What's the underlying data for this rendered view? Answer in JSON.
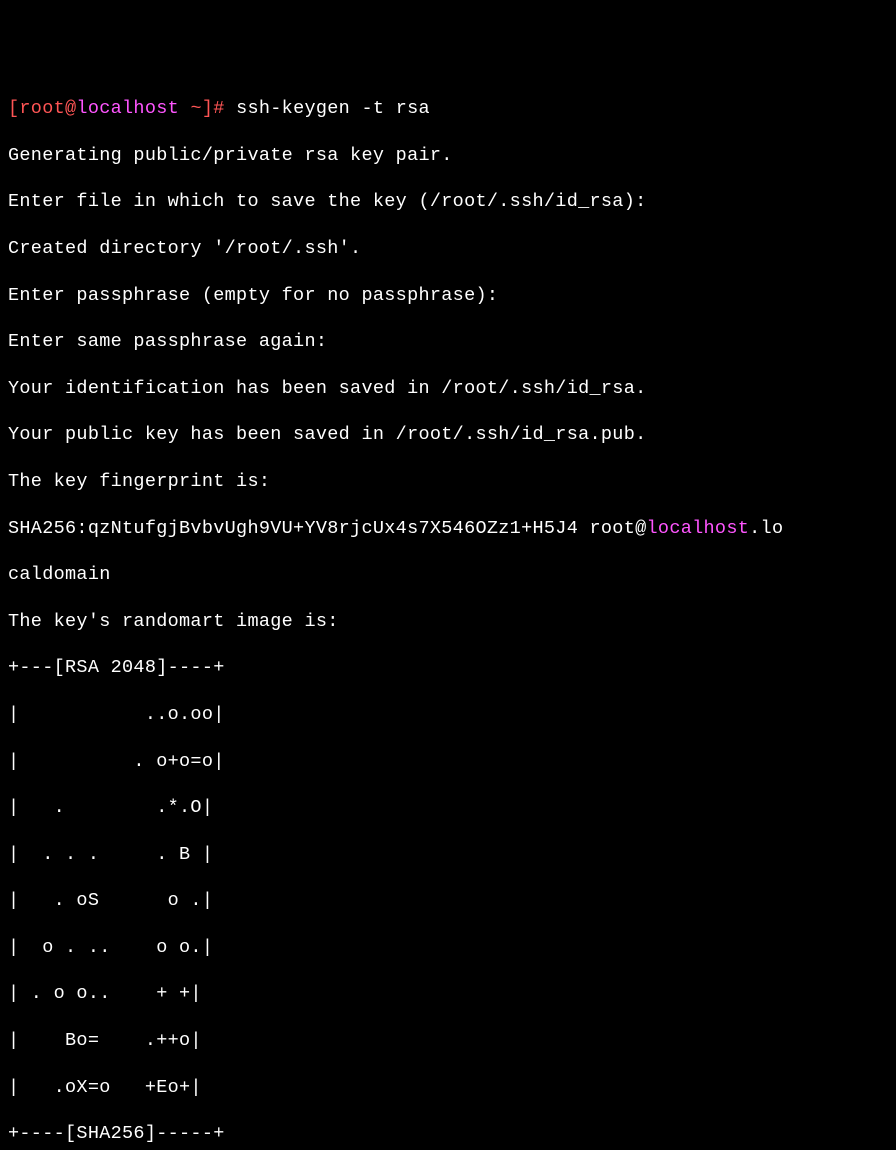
{
  "terminal": {
    "prompt_open": "[",
    "user": "root",
    "at": "@",
    "host": "localhost",
    "prompt_close": " ~]# ",
    "command": "ssh-keygen -t rsa",
    "line1": "Generating public/private rsa key pair.",
    "line2": "Enter file in which to save the key (/root/.ssh/id_rsa):",
    "line3": "Created directory '/root/.ssh'.",
    "line4": "Enter passphrase (empty for no passphrase):",
    "line5": "Enter same passphrase again:",
    "line6": "Your identification has been saved in /root/.ssh/id_rsa.",
    "line7": "Your public key has been saved in /root/.ssh/id_rsa.pub.",
    "line8": "The key fingerprint is:",
    "sha_prefix": "SHA256:qzNtufgjBvbvUgh9VU+YV8rjcUx4s7X546OZz1+H5J4 root@",
    "sha_host": "localhost",
    "sha_suffix": ".lo",
    "line10": "caldomain",
    "line11": "The key's randomart image is:",
    "art1": "+---[RSA 2048]----+",
    "art2": "|           ..o.oo|",
    "art3": "|          . o+o=o|",
    "art4": "|   .        .*.O|",
    "art5": "|  . . .     . B |",
    "art6": "|   . oS      o .|",
    "art7": "|  o . ..    o o.|",
    "art8": "| . o o..    + +|",
    "art9": "|    Bo=    .++o|",
    "art10": "|   .oX=o   +Eo+|",
    "art11": "+----[SHA256]-----+"
  }
}
